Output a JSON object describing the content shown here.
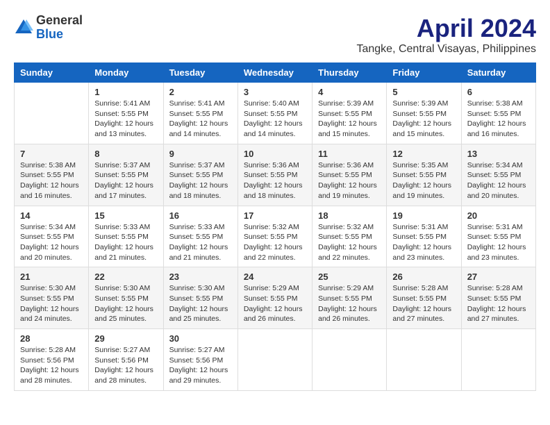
{
  "header": {
    "logo_general": "General",
    "logo_blue": "Blue",
    "title": "April 2024",
    "subtitle": "Tangke, Central Visayas, Philippines"
  },
  "calendar": {
    "days_of_week": [
      "Sunday",
      "Monday",
      "Tuesday",
      "Wednesday",
      "Thursday",
      "Friday",
      "Saturday"
    ],
    "weeks": [
      [
        {
          "day": "",
          "sunrise": "",
          "sunset": "",
          "daylight": ""
        },
        {
          "day": "1",
          "sunrise": "Sunrise: 5:41 AM",
          "sunset": "Sunset: 5:55 PM",
          "daylight": "Daylight: 12 hours and 13 minutes."
        },
        {
          "day": "2",
          "sunrise": "Sunrise: 5:41 AM",
          "sunset": "Sunset: 5:55 PM",
          "daylight": "Daylight: 12 hours and 14 minutes."
        },
        {
          "day": "3",
          "sunrise": "Sunrise: 5:40 AM",
          "sunset": "Sunset: 5:55 PM",
          "daylight": "Daylight: 12 hours and 14 minutes."
        },
        {
          "day": "4",
          "sunrise": "Sunrise: 5:39 AM",
          "sunset": "Sunset: 5:55 PM",
          "daylight": "Daylight: 12 hours and 15 minutes."
        },
        {
          "day": "5",
          "sunrise": "Sunrise: 5:39 AM",
          "sunset": "Sunset: 5:55 PM",
          "daylight": "Daylight: 12 hours and 15 minutes."
        },
        {
          "day": "6",
          "sunrise": "Sunrise: 5:38 AM",
          "sunset": "Sunset: 5:55 PM",
          "daylight": "Daylight: 12 hours and 16 minutes."
        }
      ],
      [
        {
          "day": "7",
          "sunrise": "Sunrise: 5:38 AM",
          "sunset": "Sunset: 5:55 PM",
          "daylight": "Daylight: 12 hours and 16 minutes."
        },
        {
          "day": "8",
          "sunrise": "Sunrise: 5:37 AM",
          "sunset": "Sunset: 5:55 PM",
          "daylight": "Daylight: 12 hours and 17 minutes."
        },
        {
          "day": "9",
          "sunrise": "Sunrise: 5:37 AM",
          "sunset": "Sunset: 5:55 PM",
          "daylight": "Daylight: 12 hours and 18 minutes."
        },
        {
          "day": "10",
          "sunrise": "Sunrise: 5:36 AM",
          "sunset": "Sunset: 5:55 PM",
          "daylight": "Daylight: 12 hours and 18 minutes."
        },
        {
          "day": "11",
          "sunrise": "Sunrise: 5:36 AM",
          "sunset": "Sunset: 5:55 PM",
          "daylight": "Daylight: 12 hours and 19 minutes."
        },
        {
          "day": "12",
          "sunrise": "Sunrise: 5:35 AM",
          "sunset": "Sunset: 5:55 PM",
          "daylight": "Daylight: 12 hours and 19 minutes."
        },
        {
          "day": "13",
          "sunrise": "Sunrise: 5:34 AM",
          "sunset": "Sunset: 5:55 PM",
          "daylight": "Daylight: 12 hours and 20 minutes."
        }
      ],
      [
        {
          "day": "14",
          "sunrise": "Sunrise: 5:34 AM",
          "sunset": "Sunset: 5:55 PM",
          "daylight": "Daylight: 12 hours and 20 minutes."
        },
        {
          "day": "15",
          "sunrise": "Sunrise: 5:33 AM",
          "sunset": "Sunset: 5:55 PM",
          "daylight": "Daylight: 12 hours and 21 minutes."
        },
        {
          "day": "16",
          "sunrise": "Sunrise: 5:33 AM",
          "sunset": "Sunset: 5:55 PM",
          "daylight": "Daylight: 12 hours and 21 minutes."
        },
        {
          "day": "17",
          "sunrise": "Sunrise: 5:32 AM",
          "sunset": "Sunset: 5:55 PM",
          "daylight": "Daylight: 12 hours and 22 minutes."
        },
        {
          "day": "18",
          "sunrise": "Sunrise: 5:32 AM",
          "sunset": "Sunset: 5:55 PM",
          "daylight": "Daylight: 12 hours and 22 minutes."
        },
        {
          "day": "19",
          "sunrise": "Sunrise: 5:31 AM",
          "sunset": "Sunset: 5:55 PM",
          "daylight": "Daylight: 12 hours and 23 minutes."
        },
        {
          "day": "20",
          "sunrise": "Sunrise: 5:31 AM",
          "sunset": "Sunset: 5:55 PM",
          "daylight": "Daylight: 12 hours and 23 minutes."
        }
      ],
      [
        {
          "day": "21",
          "sunrise": "Sunrise: 5:30 AM",
          "sunset": "Sunset: 5:55 PM",
          "daylight": "Daylight: 12 hours and 24 minutes."
        },
        {
          "day": "22",
          "sunrise": "Sunrise: 5:30 AM",
          "sunset": "Sunset: 5:55 PM",
          "daylight": "Daylight: 12 hours and 25 minutes."
        },
        {
          "day": "23",
          "sunrise": "Sunrise: 5:30 AM",
          "sunset": "Sunset: 5:55 PM",
          "daylight": "Daylight: 12 hours and 25 minutes."
        },
        {
          "day": "24",
          "sunrise": "Sunrise: 5:29 AM",
          "sunset": "Sunset: 5:55 PM",
          "daylight": "Daylight: 12 hours and 26 minutes."
        },
        {
          "day": "25",
          "sunrise": "Sunrise: 5:29 AM",
          "sunset": "Sunset: 5:55 PM",
          "daylight": "Daylight: 12 hours and 26 minutes."
        },
        {
          "day": "26",
          "sunrise": "Sunrise: 5:28 AM",
          "sunset": "Sunset: 5:55 PM",
          "daylight": "Daylight: 12 hours and 27 minutes."
        },
        {
          "day": "27",
          "sunrise": "Sunrise: 5:28 AM",
          "sunset": "Sunset: 5:55 PM",
          "daylight": "Daylight: 12 hours and 27 minutes."
        }
      ],
      [
        {
          "day": "28",
          "sunrise": "Sunrise: 5:28 AM",
          "sunset": "Sunset: 5:56 PM",
          "daylight": "Daylight: 12 hours and 28 minutes."
        },
        {
          "day": "29",
          "sunrise": "Sunrise: 5:27 AM",
          "sunset": "Sunset: 5:56 PM",
          "daylight": "Daylight: 12 hours and 28 minutes."
        },
        {
          "day": "30",
          "sunrise": "Sunrise: 5:27 AM",
          "sunset": "Sunset: 5:56 PM",
          "daylight": "Daylight: 12 hours and 29 minutes."
        },
        {
          "day": "",
          "sunrise": "",
          "sunset": "",
          "daylight": ""
        },
        {
          "day": "",
          "sunrise": "",
          "sunset": "",
          "daylight": ""
        },
        {
          "day": "",
          "sunrise": "",
          "sunset": "",
          "daylight": ""
        },
        {
          "day": "",
          "sunrise": "",
          "sunset": "",
          "daylight": ""
        }
      ]
    ]
  }
}
